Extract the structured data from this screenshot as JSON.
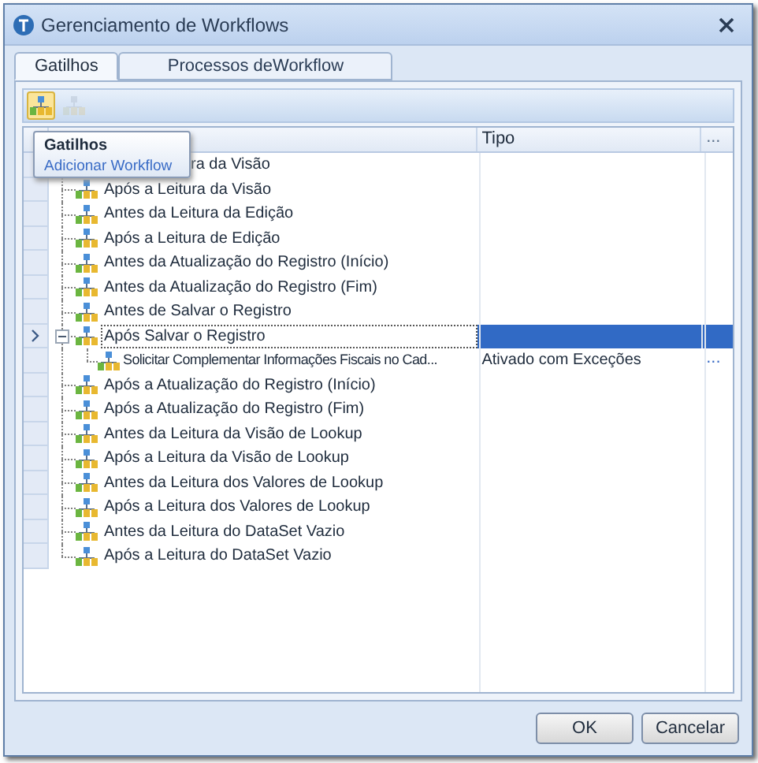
{
  "window": {
    "title": "Gerenciamento de Workflows"
  },
  "tabs": [
    {
      "label": "Gatilhos",
      "selected": true
    },
    {
      "label": "Processos deWorkflow",
      "selected": false
    }
  ],
  "toolbar": [
    {
      "disabled": false,
      "highlighted": true
    },
    {
      "disabled": true,
      "highlighted": false
    }
  ],
  "tooltip": {
    "title": "Gatilhos",
    "text": "Adicionar Workflow"
  },
  "grid": {
    "columns": [
      "Tipo",
      "..."
    ],
    "rows": [
      {
        "name": "ra da Visão",
        "kind": "covered",
        "selected": false
      },
      {
        "name": "Após a Leitura da Visão",
        "kind": "node",
        "selected": false
      },
      {
        "name": "Antes da Leitura da Edição",
        "kind": "node",
        "selected": false
      },
      {
        "name": "Após a Leitura de Edição",
        "kind": "node",
        "selected": false
      },
      {
        "name": "Antes da Atualização do Registro (Início)",
        "kind": "node",
        "selected": false
      },
      {
        "name": "Antes da Atualização do Registro (Fim)",
        "kind": "node",
        "selected": false
      },
      {
        "name": "Antes de Salvar o Registro",
        "kind": "node",
        "selected": false
      },
      {
        "name": "Após Salvar o Registro",
        "kind": "node",
        "selected": true,
        "expanded": true,
        "children": [
          {
            "name": "Solicitar Complementar Informações Fiscais no Cad...",
            "tipo": "Ativado com Exceções",
            "action": "..."
          }
        ]
      },
      {
        "name": "Após a Atualização do Registro (Início)",
        "kind": "node",
        "selected": false
      },
      {
        "name": "Após a Atualização do Registro (Fim)",
        "kind": "node",
        "selected": false
      },
      {
        "name": "Antes da Leitura da Visão de Lookup",
        "kind": "node",
        "selected": false
      },
      {
        "name": "Após a Leitura da Visão de Lookup",
        "kind": "node",
        "selected": false
      },
      {
        "name": "Antes da Leitura dos Valores de Lookup",
        "kind": "node",
        "selected": false
      },
      {
        "name": "Após a Leitura dos Valores de Lookup",
        "kind": "node",
        "selected": false
      },
      {
        "name": "Antes da Leitura do DataSet Vazio",
        "kind": "node",
        "selected": false
      },
      {
        "name": "Após a Leitura do DataSet Vazio",
        "kind": "node",
        "selected": false
      }
    ]
  },
  "buttons": [
    "OK",
    "Cancelar"
  ]
}
